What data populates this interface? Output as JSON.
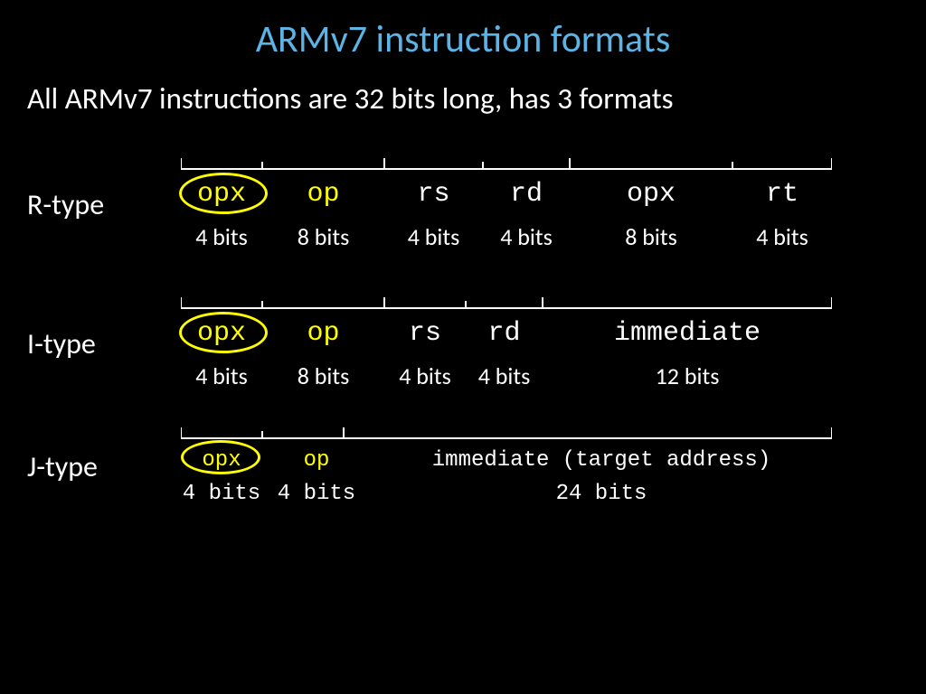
{
  "title": "ARMv7 instruction formats",
  "subtitle": "All ARMv7 instructions are 32 bits long, has 3 formats",
  "rtype": {
    "label": "R-type",
    "fields": [
      "opx",
      "op",
      "rs",
      "rd",
      "opx",
      "rt"
    ],
    "bits": [
      "4 bits",
      "8 bits",
      "4 bits",
      "4 bits",
      "8 bits",
      "4 bits"
    ]
  },
  "itype": {
    "label": "I-type",
    "fields": [
      "opx",
      "op",
      "rs",
      "rd",
      "immediate"
    ],
    "bits": [
      "4 bits",
      "8 bits",
      "4 bits",
      "4 bits",
      "12 bits"
    ]
  },
  "jtype": {
    "label": "J-type",
    "fields": [
      "opx",
      "op",
      "immediate (target address)"
    ],
    "bits": [
      "4 bits",
      "4 bits",
      "24 bits"
    ]
  }
}
